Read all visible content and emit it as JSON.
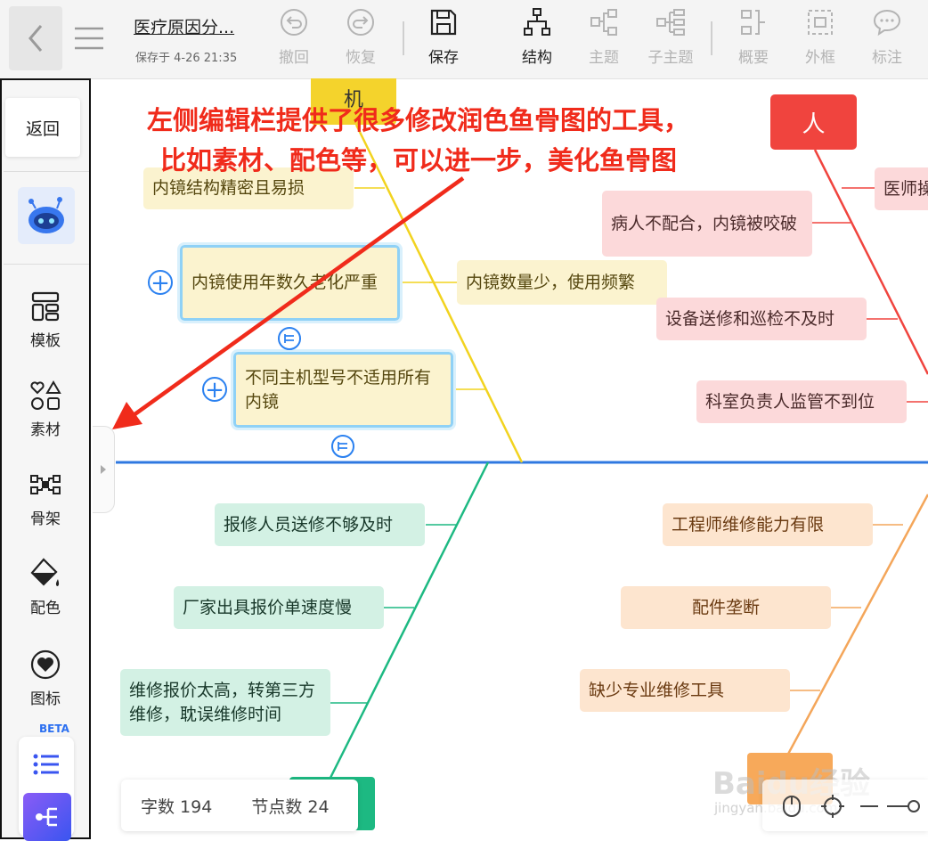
{
  "header": {
    "doc_title": "医疗原因分...",
    "save_time": "保存于 4-26 21:35",
    "tools": [
      {
        "label": "撤回",
        "icon": "undo-icon"
      },
      {
        "label": "恢复",
        "icon": "redo-icon"
      },
      {
        "label": "保存",
        "icon": "save-icon"
      },
      {
        "label": "结构",
        "icon": "structure-icon"
      },
      {
        "label": "主题",
        "icon": "topic-icon"
      },
      {
        "label": "子主题",
        "icon": "subtopic-icon"
      },
      {
        "label": "概要",
        "icon": "summary-icon"
      },
      {
        "label": "外框",
        "icon": "boundary-icon"
      },
      {
        "label": "标注",
        "icon": "callout-icon"
      }
    ]
  },
  "sidebar": {
    "back_label": "返回",
    "items": [
      {
        "label": "模板",
        "icon": "template-icon"
      },
      {
        "label": "素材",
        "icon": "material-icon"
      },
      {
        "label": "骨架",
        "icon": "skeleton-icon"
      },
      {
        "label": "配色",
        "icon": "paint-bucket-icon"
      },
      {
        "label": "图标",
        "icon": "heart-icon"
      }
    ],
    "beta_label": "BETA"
  },
  "annotation": {
    "line1": "左侧编辑栏提供了很多修改润色鱼骨图的工具，",
    "line2": "比如素材、配色等，可以进一步，美化鱼骨图"
  },
  "diagram": {
    "categories": {
      "machine": "机",
      "person": "人"
    },
    "machine_topics": [
      "内镜结构精密且易损",
      "内镜使用年数久老化严重",
      "不同主机型号不适用所有内镜",
      "内镜数量少，使用频繁"
    ],
    "person_topics": [
      "医师操",
      "病人不配合，内镜被咬破",
      "设备送修和巡检不及时",
      "科室负责人监管不到位"
    ],
    "green_topics": [
      "报修人员送修不够及时",
      "厂家出具报价单速度慢",
      "维修报价太高，转第三方维修，耽误维修时间"
    ],
    "orange_topics": [
      "工程师维修能力有限",
      "配件垄断",
      "缺少专业维修工具"
    ]
  },
  "status": {
    "word_count": "字数 194",
    "node_count": "节点数 24"
  },
  "watermark": {
    "brand": "Baidu经验",
    "url": "jingyan.baidu.com"
  },
  "colors": {
    "spine": "#2f78e0",
    "machine": "#f2d31f",
    "person": "#f0443e",
    "green": "#1db982",
    "orange": "#f4a65a",
    "annotation": "#f02b1b"
  }
}
